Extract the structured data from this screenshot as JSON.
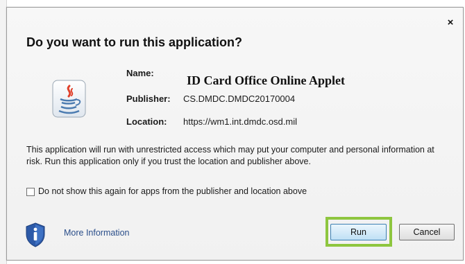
{
  "dialog": {
    "title": "Do you want to run this application?",
    "close_glyph": "×",
    "app_icon": "java-icon",
    "name_label": "Name:",
    "name_value": "ID Card Office Online Applet",
    "publisher_label": "Publisher:",
    "publisher_value": "CS.DMDC.DMDC20170004",
    "location_label": "Location:",
    "location_value": "https://wm1.int.dmdc.osd.mil",
    "warning_text": "This application will run with unrestricted access which may put your computer and personal information at risk. Run this application only if you trust the location and publisher above.",
    "checkbox_label": "Do not show this again for apps from the publisher and location above",
    "checkbox_checked": false,
    "more_info_icon": "shield-info-icon",
    "more_info_label": "More Information",
    "run_label": "Run",
    "cancel_label": "Cancel"
  },
  "colors": {
    "highlight": "#8ec63f",
    "link": "#2a4e8a",
    "shield": "#2d5aa8"
  }
}
